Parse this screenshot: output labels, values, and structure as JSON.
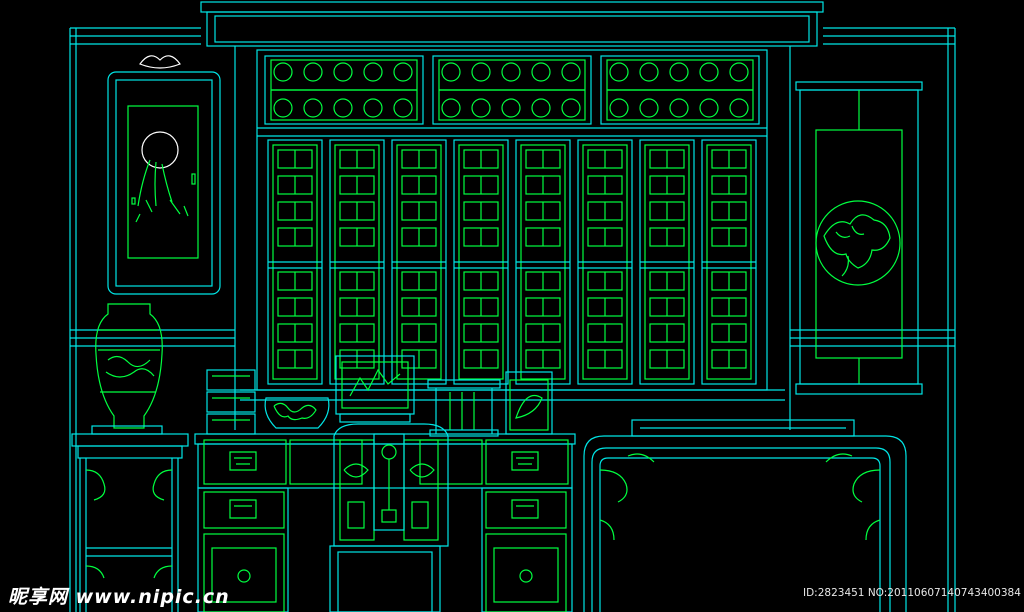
{
  "drawing": {
    "background": "#000000",
    "line_colors": {
      "outline": "#00e5e5",
      "detail": "#00ff40",
      "white": "#ffffff"
    },
    "elements": [
      "roof-beam",
      "lattice-window",
      "transom-panels",
      "wall-painting",
      "hanging-scroll",
      "porcelain-vase",
      "vase-stand",
      "writing-desk",
      "screen-chair",
      "side-table",
      "book-stack",
      "flower-bowl",
      "picture-frame",
      "pen-rack",
      "small-jar"
    ]
  },
  "watermark": {
    "logo": "昵享网 www.nipic.cn",
    "id_text": "ID:2823451 NO:20110607140743400384"
  }
}
